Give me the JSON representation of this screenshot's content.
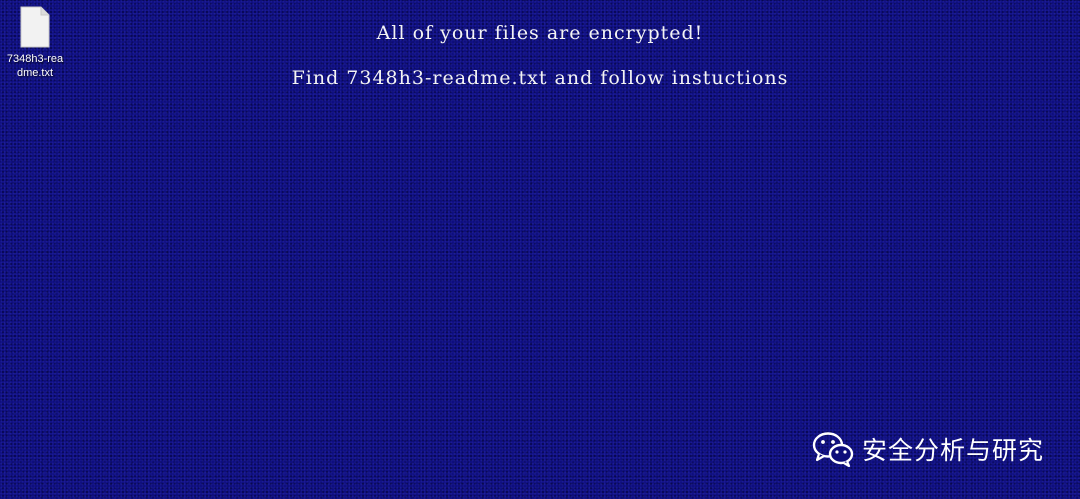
{
  "desktop": {
    "background_color": "#0c0c7a",
    "icons": [
      {
        "icon": "text-file-icon",
        "label": "7348h3-readme.txt",
        "label_line1": "7348h3-rea",
        "label_line2": "dme.txt"
      }
    ]
  },
  "ransom_message": {
    "line1": "All of your files are encrypted!",
    "line2": "Find 7348h3-readme.txt and follow instuctions",
    "text_color": "#f4f4f4"
  },
  "watermark": {
    "icon": "wechat-icon",
    "text": "安全分析与研究"
  }
}
